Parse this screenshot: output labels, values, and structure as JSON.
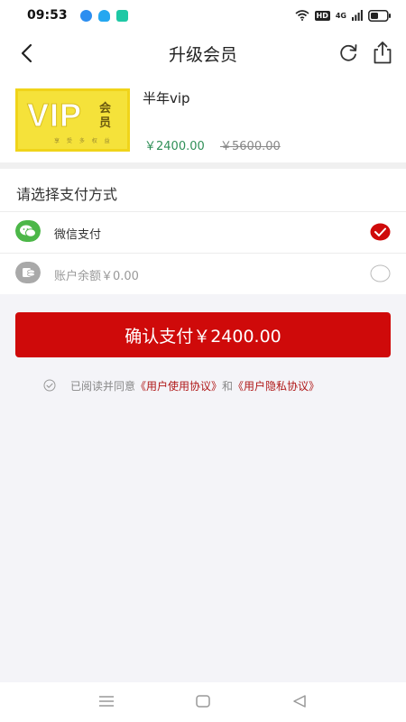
{
  "status_bar": {
    "time": "09:53",
    "hd": "HD",
    "network": "4G"
  },
  "header": {
    "title": "升级会员"
  },
  "product": {
    "badge_text": "VIP",
    "badge_word": "会员",
    "badge_sub": "享 受 多 权 益",
    "name": "半年vip",
    "price": "￥2400.00",
    "original_price": "￥5600.00"
  },
  "payment": {
    "section_title": "请选择支付方式",
    "options": [
      {
        "label": "微信支付",
        "selected": true,
        "icon": "wechat-icon"
      },
      {
        "label": "账户余额￥0.00",
        "selected": false,
        "icon": "wallet-icon"
      }
    ]
  },
  "confirm": {
    "label": "确认支付￥2400.00"
  },
  "agreement": {
    "prefix": "已阅读并同意",
    "link1": "《用户使用协议》",
    "conjunction": "和",
    "link2": "《用户隐私协议》"
  },
  "colors": {
    "accent": "#cf0a0a",
    "price": "#2f8f57",
    "link": "#b01818",
    "wechat": "#4cb748"
  }
}
